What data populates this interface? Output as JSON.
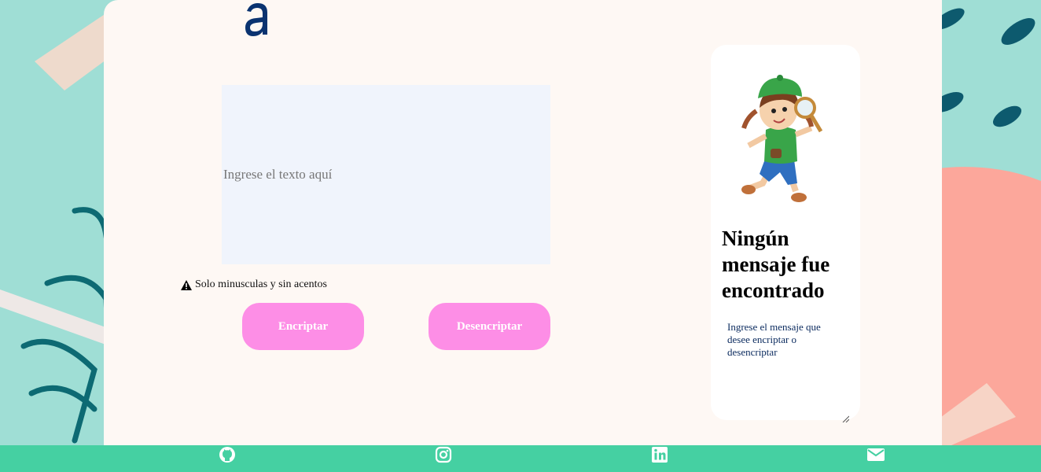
{
  "input": {
    "placeholder": "Ingrese el texto aquí"
  },
  "warning": {
    "icon": "warning-triangle-icon",
    "text": "Solo minusculas y sin acentos"
  },
  "buttons": {
    "encrypt_label": "Encriptar",
    "decrypt_label": "Desencriptar"
  },
  "output_panel": {
    "title": "Ningún mensaje fue encontrado",
    "message": "Ingrese el mensaje que desee encriptar o desencriptar"
  },
  "footer": {
    "icons": [
      "github-icon",
      "instagram-icon",
      "linkedin-icon",
      "mail-icon"
    ]
  },
  "colors": {
    "background_teal": "#9fded5",
    "paper": "#fef8f4",
    "input_bg": "#f0f4fc",
    "button_pink": "#fd8ee6",
    "footer_green": "#45d0a2",
    "logo_navy": "#0a3370",
    "coral": "#fca79b"
  }
}
